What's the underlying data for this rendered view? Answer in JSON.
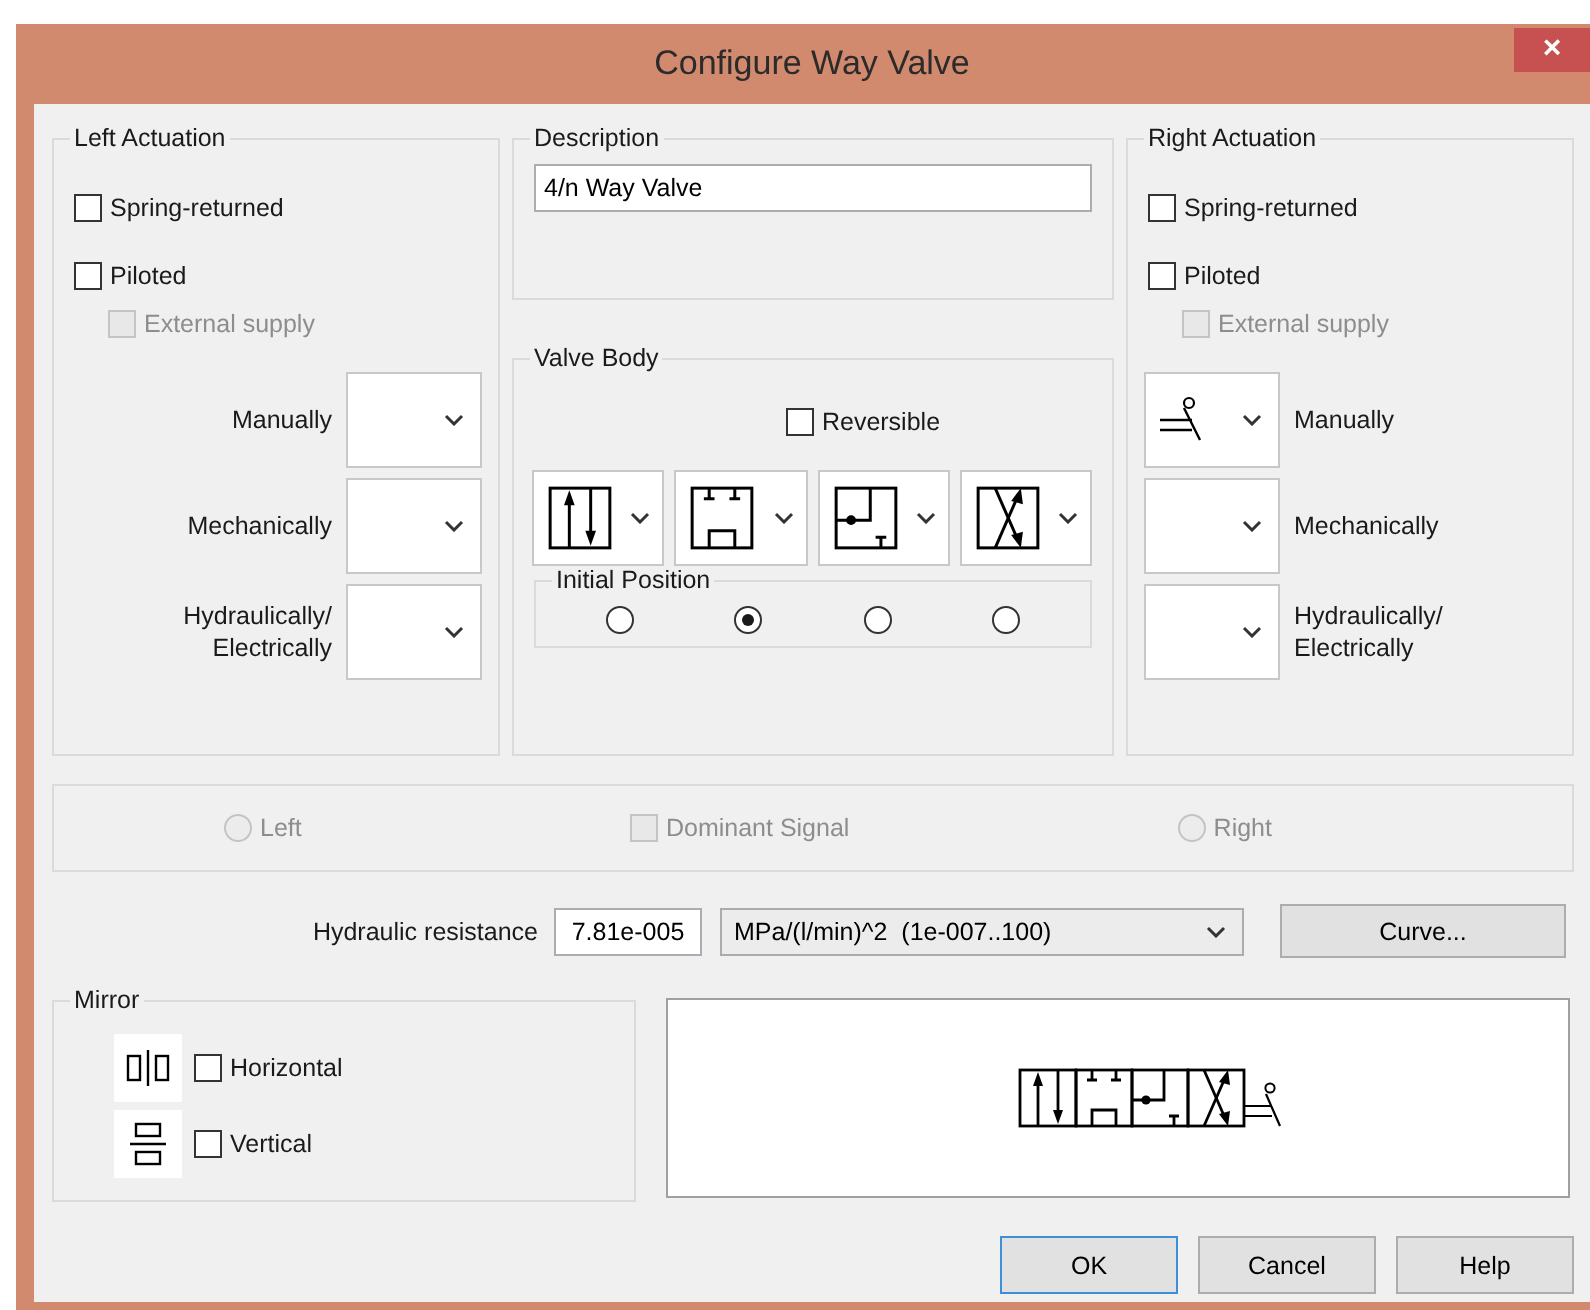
{
  "window": {
    "title": "Configure Way Valve",
    "close": "×"
  },
  "left_actuation": {
    "title": "Left Actuation",
    "options": [
      {
        "label": "Spring-returned",
        "checked": false,
        "disabled": false
      },
      {
        "label": "Piloted",
        "checked": false,
        "disabled": false,
        "children": [
          {
            "label": "External supply",
            "checked": false,
            "disabled": true
          }
        ]
      }
    ],
    "actuators": [
      {
        "label": "Manually"
      },
      {
        "label": "Mechanically"
      },
      {
        "label": "Hydraulically/\nElectrically"
      }
    ]
  },
  "description": {
    "title": "Description",
    "value": "4/n Way Valve"
  },
  "valve_body": {
    "title": "Valve Body",
    "reversible": {
      "label": "Reversible",
      "checked": false
    },
    "positions": [
      {
        "kind": "parallel"
      },
      {
        "kind": "closed"
      },
      {
        "kind": "junction"
      },
      {
        "kind": "crossed"
      }
    ],
    "initial_position": {
      "title": "Initial Position",
      "options": [
        {
          "selected": false
        },
        {
          "selected": true
        },
        {
          "selected": false
        },
        {
          "selected": false
        }
      ]
    }
  },
  "right_actuation": {
    "title": "Right Actuation",
    "options": [
      {
        "label": "Spring-returned",
        "checked": false,
        "disabled": false
      },
      {
        "label": "Piloted",
        "checked": false,
        "disabled": false,
        "children": [
          {
            "label": "External supply",
            "checked": false,
            "disabled": true
          }
        ]
      }
    ],
    "actuators": [
      {
        "label": "Manually",
        "kind": "lever"
      },
      {
        "label": "Mechanically"
      },
      {
        "label": "Hydraulically/\nElectrically"
      }
    ]
  },
  "dominance": {
    "left": {
      "label": "Left",
      "selected": false,
      "disabled": true
    },
    "signal": {
      "label": "Dominant Signal",
      "checked": false,
      "disabled": true
    },
    "right": {
      "label": "Right",
      "selected": false,
      "disabled": true
    }
  },
  "hydraulic_resistance": {
    "label": "Hydraulic resistance",
    "value": "7.81e-005",
    "unit": "MPa/(l/min)^2  (1e-007..100)",
    "button": "Curve..."
  },
  "mirror": {
    "title": "Mirror",
    "options": [
      {
        "kind": "horizontal",
        "label": "Horizontal",
        "checked": false
      },
      {
        "kind": "vertical",
        "label": "Vertical",
        "checked": false
      }
    ]
  },
  "buttons": [
    {
      "label": "OK",
      "default": true
    },
    {
      "label": "Cancel",
      "default": false
    },
    {
      "label": "Help",
      "default": false
    }
  ]
}
